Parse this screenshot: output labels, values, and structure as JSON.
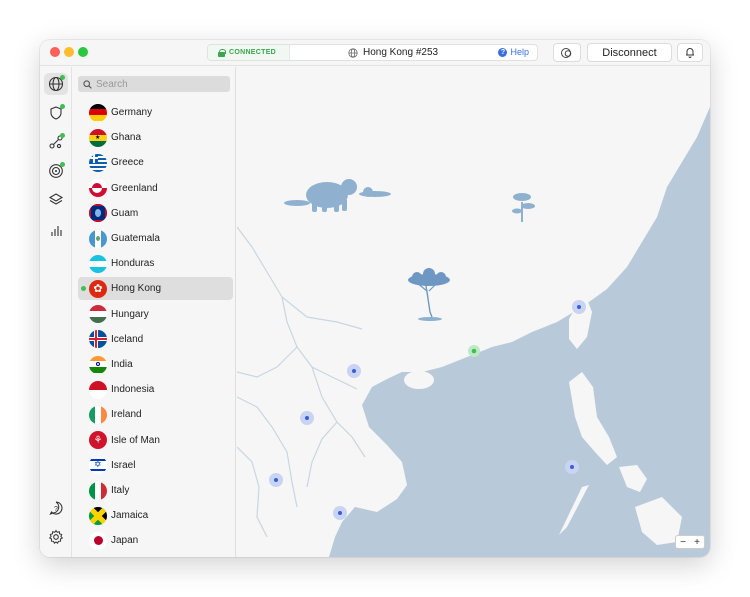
{
  "titlebar": {
    "status": "CONNECTED",
    "server": "Hong Kong #253",
    "help": "Help",
    "disconnect": "Disconnect"
  },
  "rail": {
    "items": [
      "globe-icon",
      "shield-icon",
      "meshnet-icon",
      "target-icon",
      "layers-icon",
      "stats-icon"
    ],
    "bottom": [
      "help-icon",
      "settings-icon"
    ]
  },
  "search": {
    "placeholder": "Search"
  },
  "countries": [
    {
      "name": "Germany"
    },
    {
      "name": "Ghana"
    },
    {
      "name": "Greece"
    },
    {
      "name": "Greenland"
    },
    {
      "name": "Guam"
    },
    {
      "name": "Guatemala"
    },
    {
      "name": "Honduras"
    },
    {
      "name": "Hong Kong",
      "selected": true
    },
    {
      "name": "Hungary"
    },
    {
      "name": "Iceland"
    },
    {
      "name": "India"
    },
    {
      "name": "Indonesia"
    },
    {
      "name": "Ireland"
    },
    {
      "name": "Isle of Man"
    },
    {
      "name": "Israel"
    },
    {
      "name": "Italy"
    },
    {
      "name": "Jamaica"
    },
    {
      "name": "Japan"
    }
  ],
  "map": {
    "zoom_out": "−",
    "zoom_in": "+"
  },
  "colors": {
    "accent": "#3b6fe0",
    "connected": "#3fbf52",
    "water": "#b8cad9",
    "land": "#f6f6f6"
  }
}
